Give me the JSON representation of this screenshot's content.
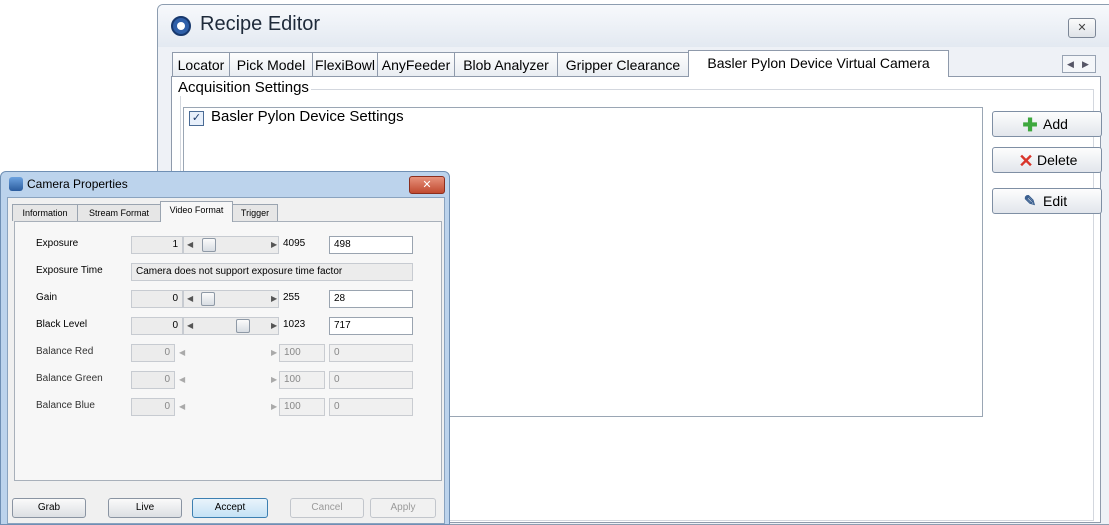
{
  "recipe_editor": {
    "title": "Recipe Editor",
    "close_glyph": "✕",
    "tabs": [
      {
        "label": "Locator",
        "active": false
      },
      {
        "label": "Pick Model",
        "active": false
      },
      {
        "label": "FlexiBowl",
        "active": false
      },
      {
        "label": "AnyFeeder",
        "active": false
      },
      {
        "label": "Blob Analyzer",
        "active": false
      },
      {
        "label": "Gripper Clearance",
        "active": false
      },
      {
        "label": "Basler Pylon Device Virtual Camera",
        "active": true
      }
    ],
    "group_label": "Acquisition Settings",
    "list_items": [
      {
        "label": "Basler Pylon Device Settings",
        "checked": true
      }
    ],
    "buttons": {
      "add": "Add",
      "delete": "Delete",
      "edit": "Edit"
    },
    "colors": {
      "add_icon": "#3ea83e",
      "delete_icon": "#d9352a"
    }
  },
  "camera_properties": {
    "title": "Camera Properties",
    "tabs": [
      {
        "label": "Information",
        "active": false
      },
      {
        "label": "Stream Format",
        "active": false
      },
      {
        "label": "Video Format",
        "active": true
      },
      {
        "label": "Trigger",
        "active": false
      }
    ],
    "exposure_time_label": "Exposure Time",
    "exposure_time_note": "Camera does not support exposure time factor",
    "rows": [
      {
        "label": "Exposure",
        "min": "1",
        "max": "4095",
        "value": "498",
        "enabled": true
      },
      {
        "label": "Gain",
        "min": "0",
        "max": "255",
        "value": "28",
        "enabled": true
      },
      {
        "label": "Black Level",
        "min": "0",
        "max": "1023",
        "value": "717",
        "enabled": true
      },
      {
        "label": "Balance Red",
        "min": "0",
        "max": "100",
        "value": "0",
        "enabled": false
      },
      {
        "label": "Balance Green",
        "min": "0",
        "max": "100",
        "value": "0",
        "enabled": false
      },
      {
        "label": "Balance Blue",
        "min": "0",
        "max": "100",
        "value": "0",
        "enabled": false
      }
    ],
    "buttons": {
      "grab": "Grab",
      "live": "Live",
      "accept": "Accept",
      "cancel": "Cancel",
      "apply": "Apply"
    }
  }
}
